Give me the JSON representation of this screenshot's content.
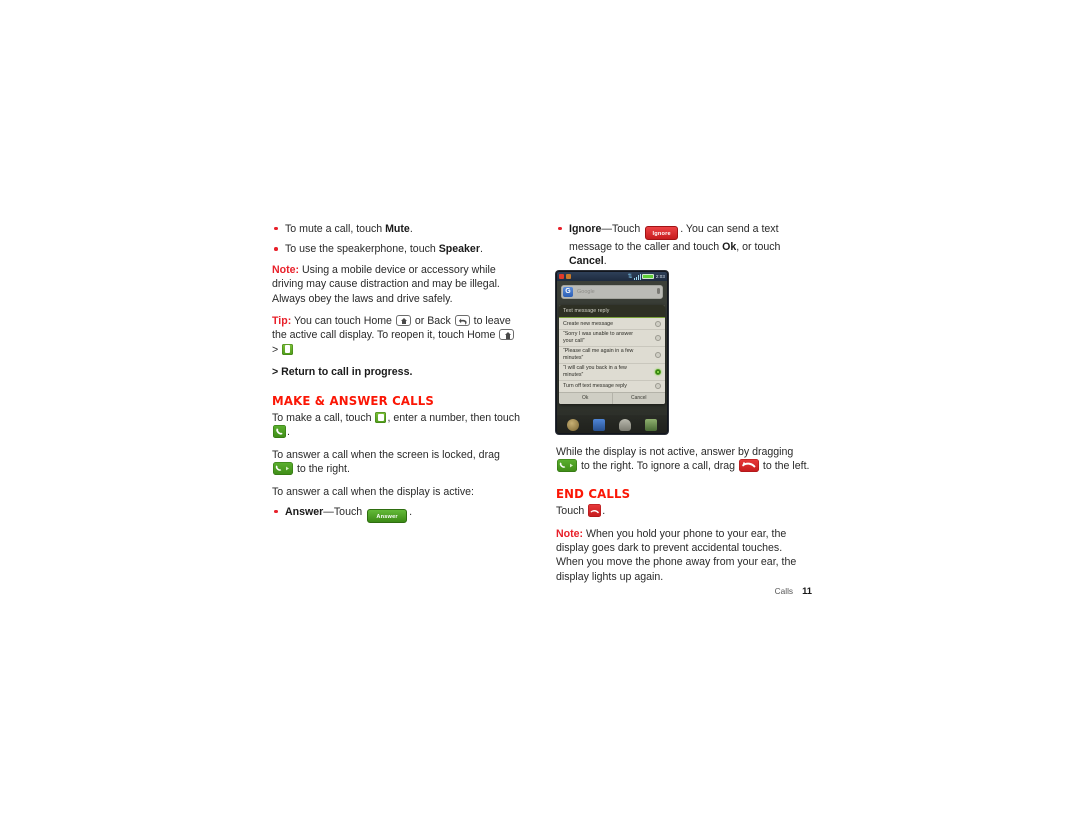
{
  "page": {
    "footer_label": "Calls",
    "footer_page_number": "11",
    "accent_red": "#fb1605",
    "note_red": "#e8202a",
    "green": "#4f9c1b"
  },
  "left_column": {
    "bullets": [
      {
        "pre": "To mute a call, touch ",
        "bold": "Mute",
        "post": "."
      },
      {
        "pre": "To use the speakerphone, touch ",
        "bold": "Speaker",
        "post": "."
      }
    ],
    "note": {
      "label": "Note:",
      "text": " Using a mobile device or accessory while driving may cause distraction and may be illegal. Always obey the laws and drive safely."
    },
    "tip": {
      "label": "Tip:",
      "part1": " You can touch Home ",
      "part2": " or Back ",
      "part3": " to leave the active call display. To reopen it, touch Home ",
      "part4": " > ",
      "subref": "> Return to call in progress."
    },
    "section_heading": "MAKE & ANSWER CALLS",
    "make_call": {
      "part1": "To make a call, touch ",
      "part2": ", enter a number, then touch ",
      "part3": "."
    },
    "locked_answer": {
      "part1": "To answer a call when the screen is locked, drag ",
      "part2": " to the right."
    },
    "active_display": "To answer a call when the display is active:",
    "answer_bullet": {
      "bold": "Answer",
      "dash": "—Touch ",
      "button_label": "Answer",
      "post": "."
    }
  },
  "right_column": {
    "ignore_bullet": {
      "bold": "Ignore",
      "dash": "—Touch ",
      "button_label": "Ignore",
      "part2": ". You can send a text message to the caller and touch ",
      "bold2": "Ok",
      "part3": ", or touch ",
      "bold3": "Cancel",
      "post": "."
    },
    "drag_para": {
      "part1": "While the display is not active, answer by dragging ",
      "part2": " to the right. To ignore a call, drag ",
      "part3": " to the left."
    },
    "section_heading": "END CALLS",
    "touch_para": {
      "part1": "Touch ",
      "part2": "."
    },
    "note": {
      "label": "Note:",
      "text": " When you hold your phone to your ear, the display goes dark to prevent accidental touches. When you move the phone away from your ear, the display lights up again."
    }
  },
  "phone_screenshot": {
    "status_bar": {
      "time": "2:03",
      "icons": [
        "alarm-icon",
        "sim-icon",
        "bluetooth-icon",
        "signal-icon",
        "battery-icon"
      ]
    },
    "search_widget": {
      "logo": "G",
      "placeholder": "Google",
      "mic": "mic-icon"
    },
    "dialog": {
      "title": "Text message reply",
      "items": [
        {
          "label": "Create new message",
          "selected": false
        },
        {
          "label": "“Sorry I was unable to answer your call”",
          "selected": false
        },
        {
          "label": "“Please call me again in a few minutes”",
          "selected": false
        },
        {
          "label": "“I will call you back in a few minutes”",
          "selected": true
        },
        {
          "label": "Turn off text message reply",
          "selected": false
        }
      ],
      "ok_label": "Ok",
      "cancel_label": "Cancel"
    },
    "dock": [
      "clock-icon",
      "contacts-icon",
      "launcher-icon",
      "camera-icon"
    ]
  }
}
